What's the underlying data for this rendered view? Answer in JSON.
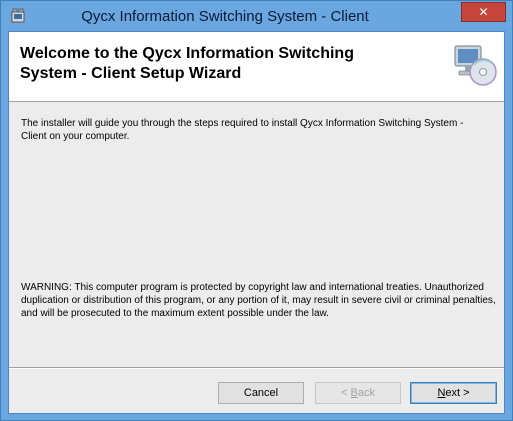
{
  "window": {
    "title": "Qycx Information Switching System - Client",
    "close_symbol": "✕"
  },
  "banner": {
    "title_line1": "Welcome to the Qycx Information Switching",
    "title_line2": "System - Client Setup Wizard",
    "icon": "computer-disc-icon"
  },
  "body": {
    "intro": "The installer will guide you through the steps required to install Qycx Information Switching System - Client on your computer.",
    "warning": "WARNING: This computer program is protected by copyright law and international treaties. Unauthorized duplication or distribution of this program, or any portion of it, may result in severe civil or criminal penalties, and will be prosecuted to the maximum extent possible under the law."
  },
  "buttons": {
    "cancel": "Cancel",
    "back_prefix": "< ",
    "back_accel": "B",
    "back_rest": "ack",
    "next_accel": "N",
    "next_rest": "ext >"
  },
  "colors": {
    "titlebar": "#6aa6e0",
    "close": "#c7463c",
    "dialog_bg": "#ececec"
  }
}
